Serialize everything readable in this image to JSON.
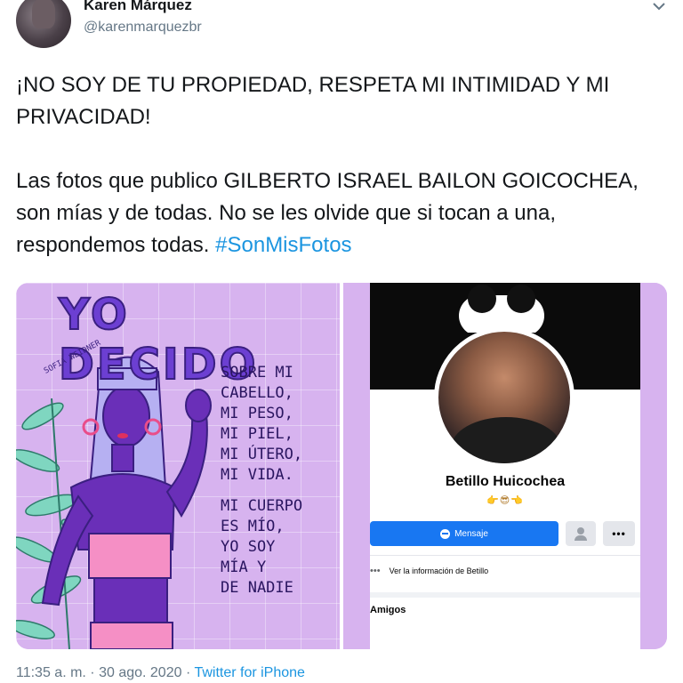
{
  "author": {
    "display_name": "Karen Márquez",
    "handle": "@karenmarquezbr"
  },
  "tweet": {
    "paragraph1": "¡NO SOY DE TU PROPIEDAD, RESPETA MI INTIMIDAD Y MI PRIVACIDAD!",
    "paragraph2": "Las fotos que publico GILBERTO ISRAEL BAILON GOICOCHEA, son mías y de todas. No se les olvide que si tocan a una, respondemos todas.",
    "hashtag": "#SonMisFotos"
  },
  "media": {
    "illustration": {
      "title": "YO DECIDO",
      "signature": "SOFIA WEIDNER",
      "lines_part1": [
        "SOBRE MI",
        "CABELLO,",
        "MI PESO,",
        "MI PIEL,",
        "MI ÚTERO,",
        "MI VIDA."
      ],
      "lines_part2": [
        "MI CUERPO",
        "ES MÍO,",
        "YO SOY",
        "MÍA Y",
        "DE NADIE"
      ]
    },
    "facebook_profile": {
      "name": "Betillo Huicochea",
      "emoji_line": "👉😎👈",
      "message_button": "Mensaje",
      "more_button": "•••",
      "info_dots": "•••",
      "info_link": "Ver la información de Betillo",
      "friends_heading": "Amigos"
    }
  },
  "footer": {
    "time": "11:35 a. m.",
    "separator1": " · ",
    "date": "30 ago. 2020",
    "separator2": " · ",
    "source": "Twitter for iPhone"
  },
  "colors": {
    "link": "#1b95e0",
    "text": "#14171a",
    "secondary": "#657786",
    "illustration_bg": "#d7b3ef",
    "facebook_blue": "#1877f2"
  },
  "icons": [
    "chevron-down-icon",
    "messenger-icon",
    "add-friend-icon",
    "more-icon"
  ]
}
